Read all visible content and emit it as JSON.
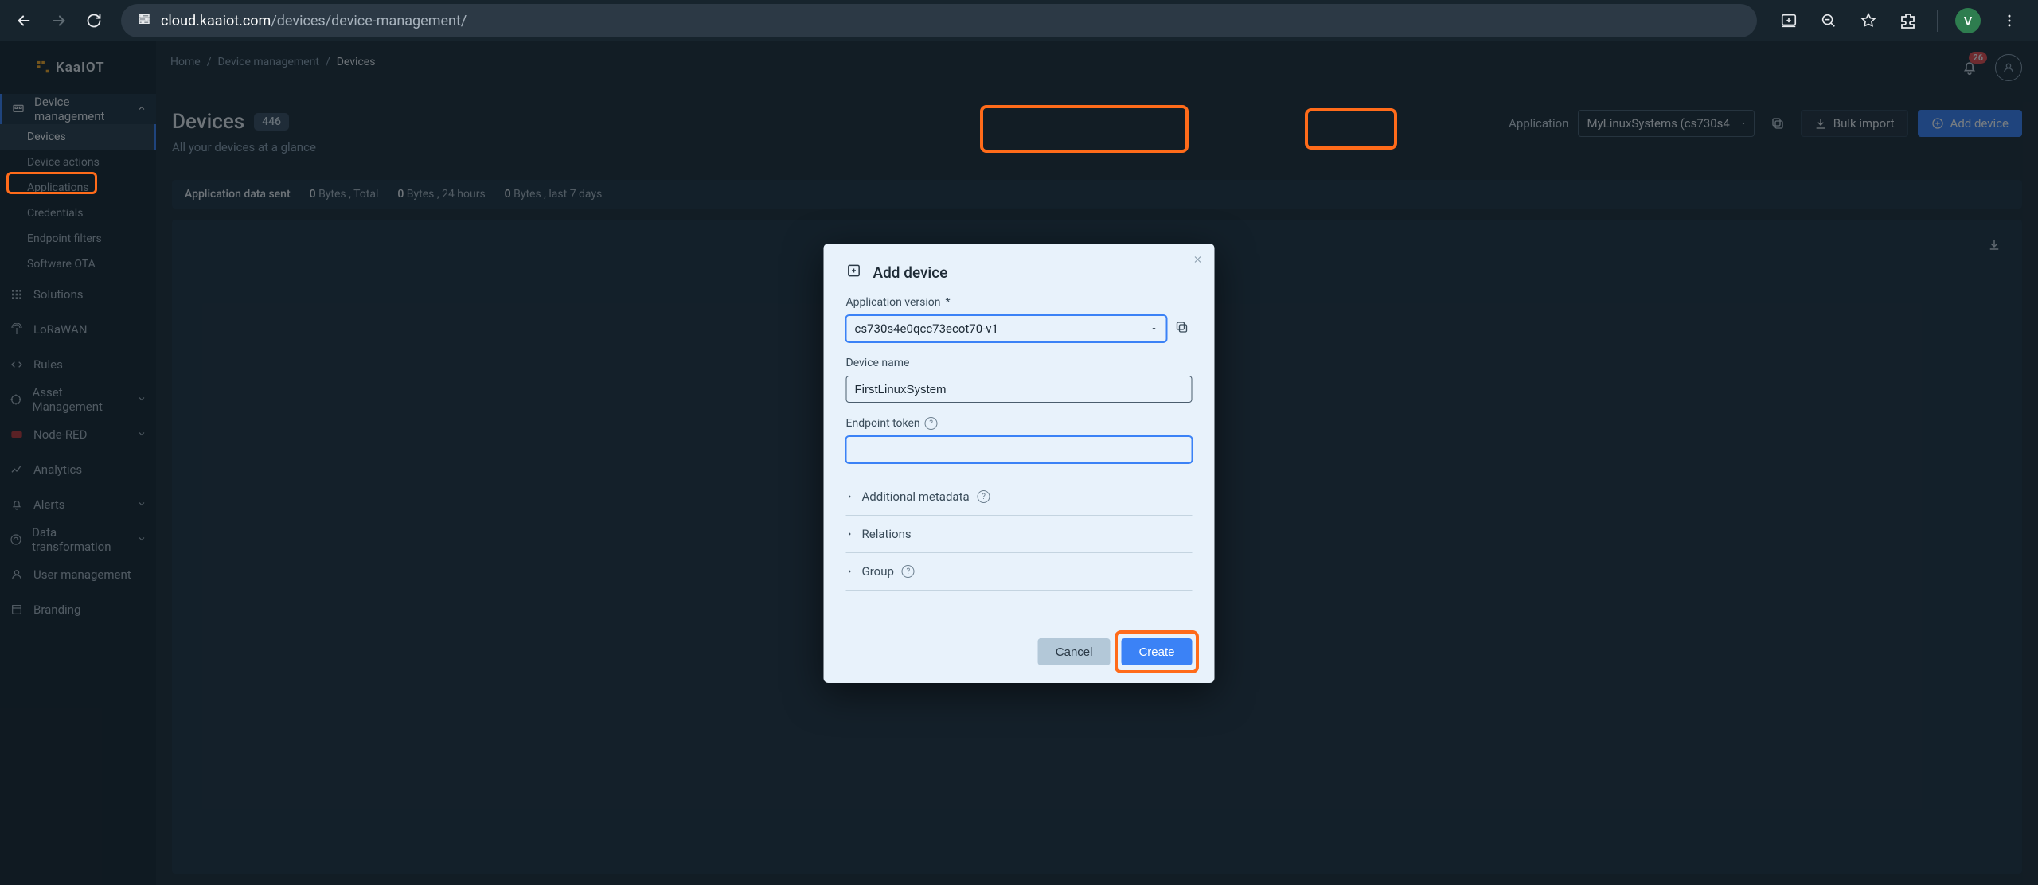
{
  "browser": {
    "url_domain": "cloud.kaaiot.com",
    "url_path": "/devices/device-management/",
    "avatar_initial": "V"
  },
  "logo": "KaaIOT",
  "notifications": {
    "count": "26"
  },
  "breadcrumb": {
    "home": "Home",
    "dm": "Device management",
    "devices": "Devices"
  },
  "page": {
    "title": "Devices",
    "count": "446",
    "subtitle": "All your devices at a glance"
  },
  "header": {
    "application_label": "Application",
    "application_value": "MyLinuxSystems (cs730s4",
    "bulk_import": "Bulk import",
    "add_device": "Add device"
  },
  "stats": {
    "label": "Application data sent",
    "v1": "0",
    "u1": "Bytes , Total",
    "v2": "0",
    "u2": "Bytes , 24 hours",
    "v3": "0",
    "u3": "Bytes , last 7 days"
  },
  "sidebar": {
    "device_management": "Device management",
    "sub": {
      "devices": "Devices",
      "device_actions": "Device actions",
      "applications": "Applications",
      "credentials": "Credentials",
      "endpoint_filters": "Endpoint filters",
      "software_ota": "Software OTA"
    },
    "solutions": "Solutions",
    "lorawan": "LoRaWAN",
    "rules": "Rules",
    "asset_management": "Asset Management",
    "node_red": "Node-RED",
    "analytics": "Analytics",
    "alerts": "Alerts",
    "data_transformation": "Data transformation",
    "user_management": "User management",
    "branding": "Branding"
  },
  "modal": {
    "title": "Add device",
    "app_version_label": "Application version",
    "app_version_value": "cs730s4e0qcc73ecot70-v1",
    "device_name_label": "Device name",
    "device_name_value": "FirstLinuxSystem",
    "endpoint_token_label": "Endpoint token",
    "endpoint_token_value": "",
    "additional_metadata": "Additional metadata",
    "relations": "Relations",
    "group": "Group",
    "cancel": "Cancel",
    "create": "Create"
  }
}
